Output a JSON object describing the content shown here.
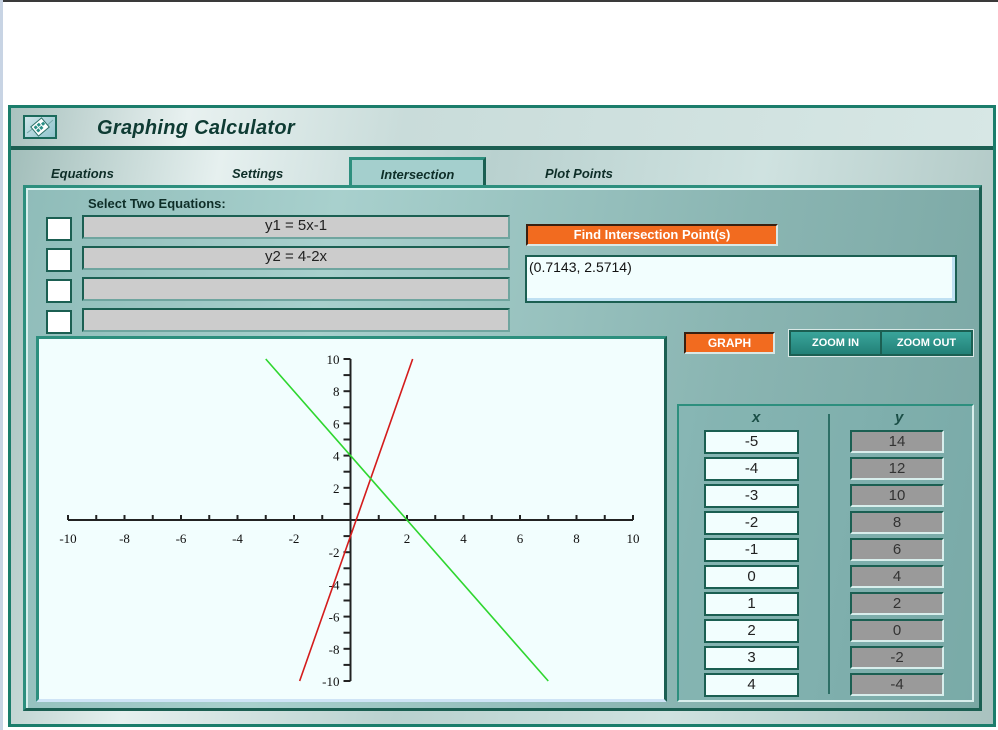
{
  "app": {
    "title": "Graphing Calculator",
    "logo_icon": "calculator-graph-icon"
  },
  "tabs": [
    {
      "label": "Equations",
      "active": false
    },
    {
      "label": "Settings",
      "active": false
    },
    {
      "label": "Intersection",
      "active": true
    },
    {
      "label": "Plot Points",
      "active": false
    }
  ],
  "intersection": {
    "select_label": "Select Two Equations:",
    "equations": [
      {
        "text": "y1 = 5x-1",
        "checked": false
      },
      {
        "text": "y2 = 4-2x",
        "checked": false
      },
      {
        "text": "",
        "checked": false
      },
      {
        "text": "",
        "checked": false
      }
    ],
    "find_button": "Find Intersection Point(s)",
    "result": "(0.7143, 2.5714)"
  },
  "controls": {
    "graph_button": "GRAPH",
    "zoom_in_button": "ZOOM IN",
    "zoom_out_button": "ZOOM OUT"
  },
  "table": {
    "x_header": "x",
    "y_header": "y",
    "x_values": [
      "-5",
      "-4",
      "-3",
      "-2",
      "-1",
      "0",
      "1",
      "2",
      "3",
      "4"
    ],
    "y_values": [
      "14",
      "12",
      "10",
      "8",
      "6",
      "4",
      "2",
      "0",
      "-2",
      "-4"
    ]
  },
  "chart_data": {
    "type": "line",
    "title": "",
    "xlabel": "",
    "ylabel": "",
    "xlim": [
      -10,
      10
    ],
    "ylim": [
      -10,
      10
    ],
    "x_ticks": [
      "-10",
      "-8",
      "-6",
      "-4",
      "-2",
      "2",
      "4",
      "6",
      "8",
      "10"
    ],
    "y_ticks": [
      "10",
      "8",
      "6",
      "4",
      "2",
      "-2",
      "-4",
      "-6",
      "-8",
      "-10"
    ],
    "grid": false,
    "series": [
      {
        "name": "y1 = 5x-1",
        "color": "#d41c1c",
        "x": [
          -1.8,
          2.2
        ],
        "y": [
          -10,
          10
        ]
      },
      {
        "name": "y2 = 4-2x",
        "color": "#2fd62f",
        "x": [
          -3,
          7
        ],
        "y": [
          10,
          -10
        ]
      }
    ]
  }
}
